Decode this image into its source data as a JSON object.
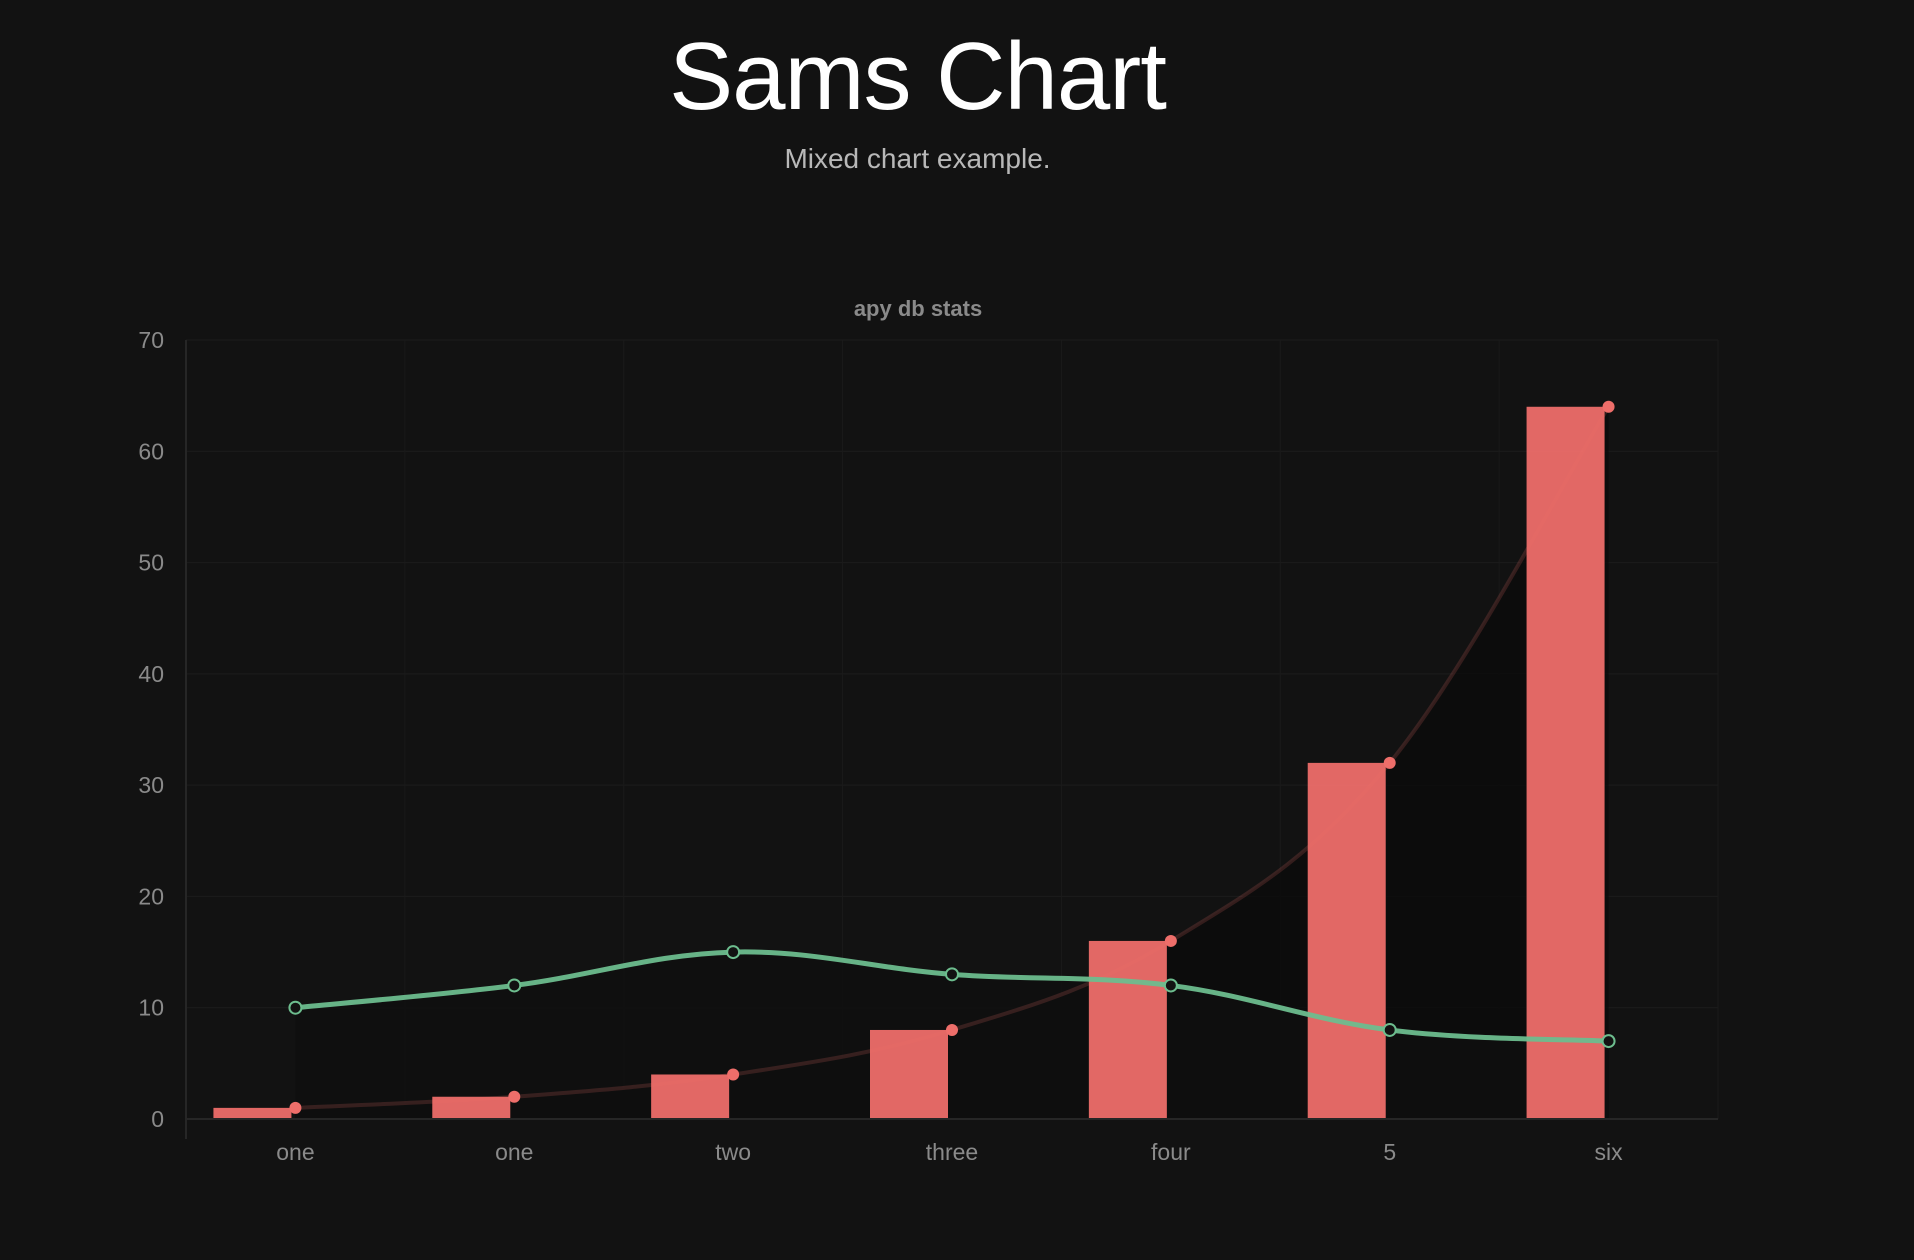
{
  "header": {
    "title": "Sams Chart",
    "subtitle": "Mixed chart example."
  },
  "chart_data": {
    "type": "bar",
    "title": "apy db stats",
    "categories": [
      "one",
      "one",
      "two",
      "three",
      "four",
      "5",
      "six"
    ],
    "ylim": [
      0,
      70
    ],
    "yticks": [
      0,
      10,
      20,
      30,
      40,
      50,
      60,
      70
    ],
    "grid": true,
    "series": [
      {
        "type": "bar",
        "values": [
          1,
          2,
          4,
          8,
          16,
          32,
          64
        ],
        "color": "#ee6e6a"
      },
      {
        "type": "line",
        "values": [
          1,
          2,
          4,
          8,
          16,
          32,
          64
        ],
        "color": "#ee6e6a",
        "fill": "#0c0c0c"
      },
      {
        "type": "line",
        "values": [
          10,
          12,
          15,
          13,
          12,
          8,
          7
        ],
        "color": "#6dbd8e",
        "fill": "#0f0f0f"
      }
    ]
  }
}
